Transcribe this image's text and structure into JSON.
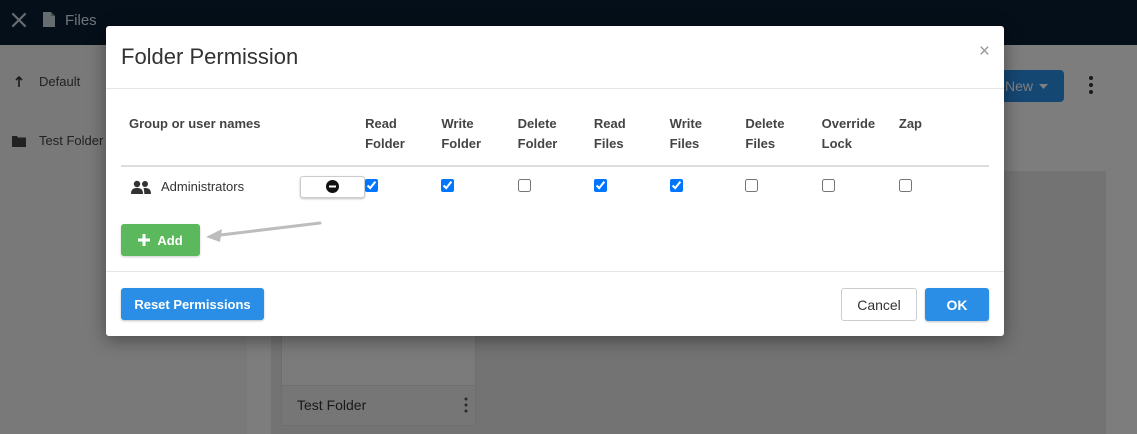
{
  "app": {
    "title": "Files",
    "new_button_label": "New",
    "sidebar": {
      "items": [
        {
          "label": "Default",
          "icon": "upload-arrow-icon"
        },
        {
          "label": "Test Folder",
          "icon": "folder-icon"
        }
      ]
    },
    "folder_card": {
      "label": "Test Folder"
    }
  },
  "dialog": {
    "title": "Folder Permission",
    "close_glyph": "×",
    "columns": {
      "group": "Group or user names",
      "read_folder": [
        "Read",
        "Folder"
      ],
      "write_folder": [
        "Write",
        "Folder"
      ],
      "delete_folder": [
        "Delete",
        "Folder"
      ],
      "read_files": [
        "Read",
        "Files"
      ],
      "write_files": [
        "Write",
        "Files"
      ],
      "delete_files": [
        "Delete",
        "Files"
      ],
      "override_lock": [
        "Override",
        "Lock"
      ],
      "zap": [
        "Zap",
        ""
      ]
    },
    "rows": [
      {
        "name": "Administrators",
        "icon": "users-icon",
        "permissions": {
          "read_folder": true,
          "write_folder": true,
          "delete_folder": false,
          "read_files": true,
          "write_files": true,
          "delete_files": false,
          "override_lock": false,
          "zap": false
        }
      }
    ],
    "add_label": "Add",
    "reset_label": "Reset Permissions",
    "cancel_label": "Cancel",
    "ok_label": "OK"
  },
  "colors": {
    "topbar": "#0b1f33",
    "primary": "#2a8ee6",
    "success": "#5cb85c",
    "overlay": "rgba(0,0,0,0.5)"
  }
}
